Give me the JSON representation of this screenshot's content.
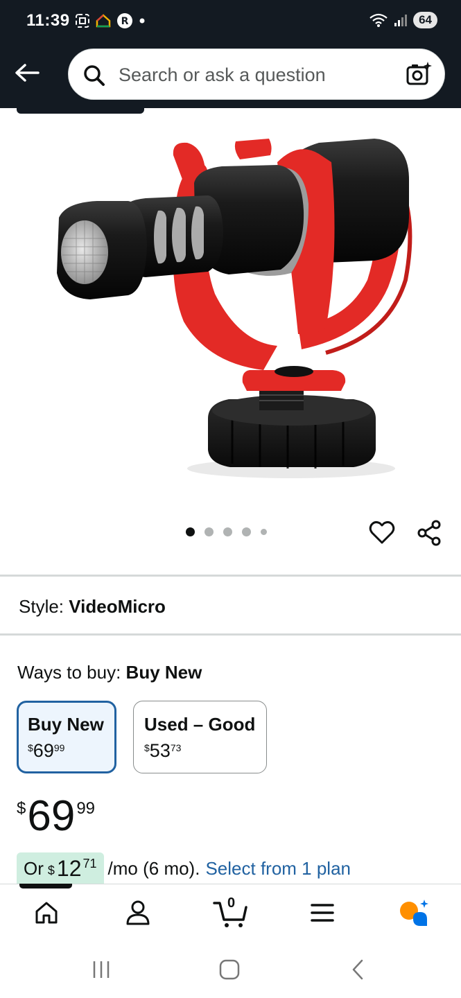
{
  "status_bar": {
    "time": "11:39",
    "battery": "64"
  },
  "search": {
    "placeholder": "Search or ask a question"
  },
  "gallery": {
    "image_count": 5,
    "active_index": 0
  },
  "product": {
    "style_label": "Style:",
    "style_value": "VideoMicro",
    "ways_label": "Ways to buy:",
    "ways_value": "Buy New",
    "options": [
      {
        "title": "Buy New",
        "currency": "$",
        "whole": "69",
        "fraction": "99",
        "selected": true
      },
      {
        "title": "Used – Good",
        "currency": "$",
        "whole": "53",
        "fraction": "73",
        "selected": false
      }
    ],
    "price": {
      "currency": "$",
      "whole": "69",
      "fraction": "99"
    },
    "monthly": {
      "prefix": "Or",
      "currency": "$",
      "whole": "12",
      "fraction": "71",
      "suffix": "/mo (6 mo).",
      "link": "Select from 1 plan"
    }
  },
  "bottom_nav": {
    "cart_count": "0",
    "items": [
      "home-icon",
      "account-icon",
      "cart-icon",
      "menu-icon",
      "rufus-icon"
    ]
  },
  "colors": {
    "header_bg": "#131a22",
    "link": "#2162a1",
    "selected_border": "#2162a1",
    "monthly_bg": "#cfeee0",
    "mic_red": "#e32a26"
  }
}
